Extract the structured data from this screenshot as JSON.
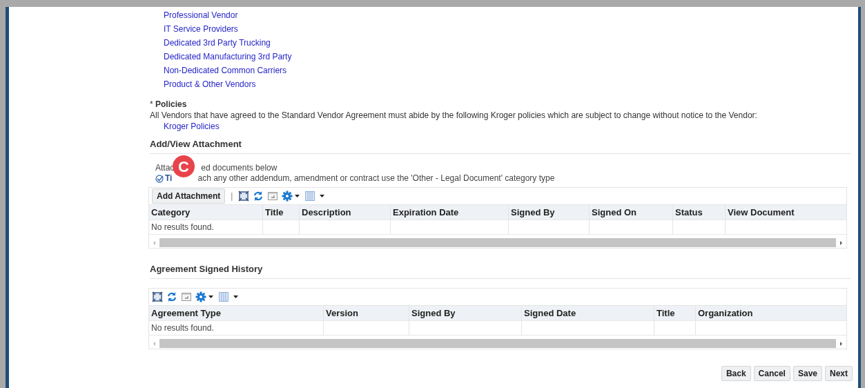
{
  "vendor_links": [
    "Professional Vendor",
    "IT Service Providers",
    "Dedicated 3rd Party Trucking",
    "Dedicated Manufacturing 3rd Party",
    "Non-Dedicated Common Carriers",
    "Product & Other Vendors"
  ],
  "policies": {
    "required_mark": "*",
    "label": "Policies",
    "text": "All Vendors that have agreed to the Standard Vendor Agreement must abide by the following Kroger policies which are subject to change without notice to the Vendor:",
    "link": "Kroger Policies"
  },
  "attachments": {
    "title": "Add/View Attachment",
    "instruction_before": "Attac",
    "instruction_after": "ed documents below",
    "tip_label": "Ti",
    "tip_text": "ach any other addendum, amendment or contract use the 'Other - Legal Document' category type",
    "add_button": "Add Attachment",
    "separator": "|",
    "columns": [
      "Category",
      "Title",
      "Description",
      "Expiration Date",
      "Signed By",
      "Signed On",
      "Status",
      "View Document"
    ],
    "empty": "No results found."
  },
  "history": {
    "title": "Agreement Signed History",
    "columns": [
      "Agreement Type",
      "Version",
      "Signed By",
      "Signed Date",
      "Title",
      "Organization"
    ],
    "empty": "No results found."
  },
  "marker": "C",
  "buttons": [
    "Back",
    "Cancel",
    "Save",
    "Next"
  ]
}
